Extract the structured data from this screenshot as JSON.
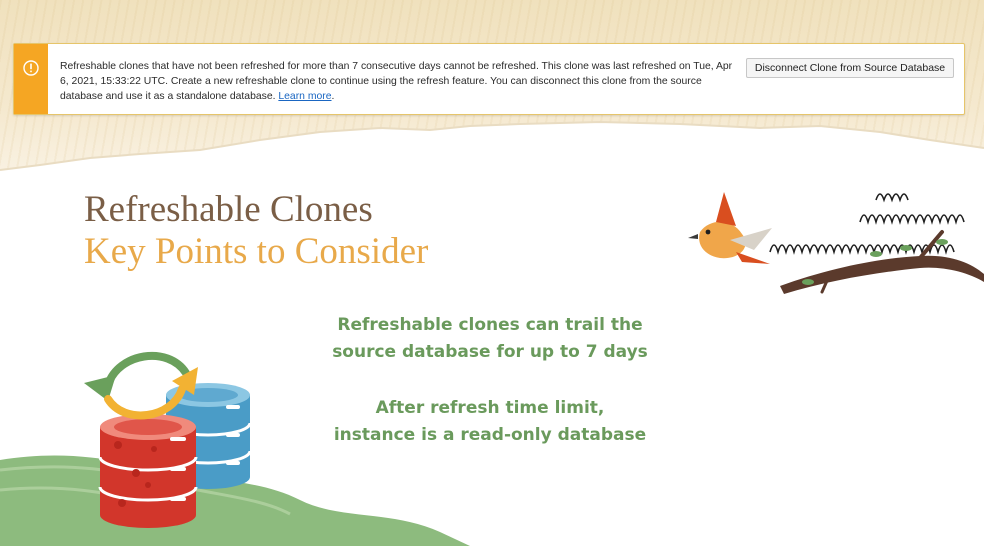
{
  "alert": {
    "icon": "warning-icon",
    "message": "Refreshable clones that have not been refreshed for more than 7 consecutive days cannot be refreshed. This clone was last refreshed on Tue, Apr 6, 2021, 15:33:22 UTC. Create a new refreshable clone to continue using the refresh feature. You can disconnect this clone from the source database and use it as a standalone database. ",
    "link_text": "Learn more",
    "link_suffix": ".",
    "button_label": "Disconnect Clone from Source Database",
    "accent_color": "#f5a623"
  },
  "slide": {
    "title_line1": "Refreshable Clones",
    "title_line2": "Key Points to Consider",
    "point1_line1": "Refreshable clones can trail the",
    "point1_line2": "source database for up to 7 days",
    "point2_line1": "After refresh time limit,",
    "point2_line2": "instance is a read-only database",
    "colors": {
      "title_brown": "#7a5e46",
      "title_orange": "#e8a94a",
      "point_green": "#6a9a5c"
    }
  }
}
